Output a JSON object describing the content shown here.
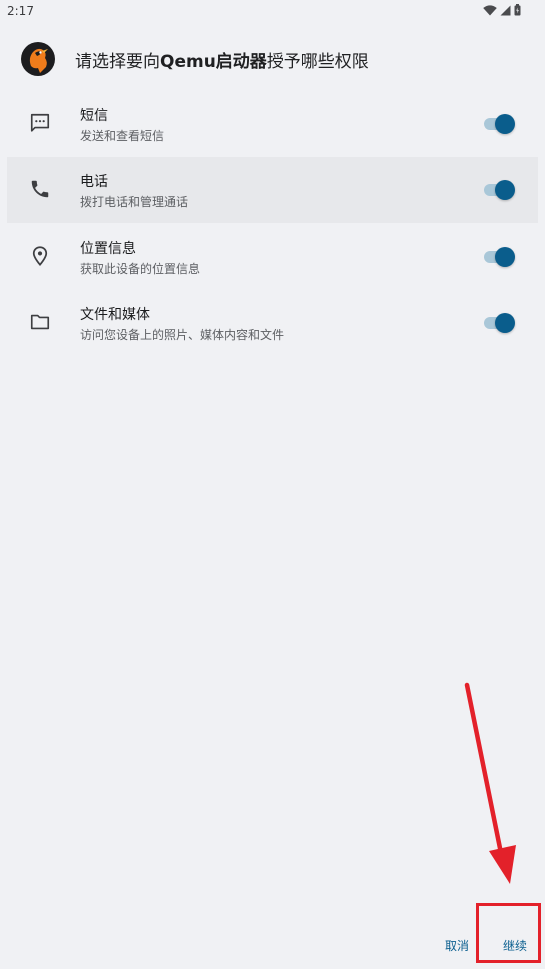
{
  "status_bar": {
    "time": "2:17",
    "icons": [
      "wifi-icon",
      "signal-icon",
      "battery-icon"
    ]
  },
  "header": {
    "prefix": "请选择要向",
    "app_name": "Qemu启动器",
    "suffix": "授予哪些权限"
  },
  "permissions": [
    {
      "title": "短信",
      "description": "发送和查看短信",
      "icon": "sms-icon",
      "enabled": true
    },
    {
      "title": "电话",
      "description": "拨打电话和管理通话",
      "icon": "phone-icon",
      "enabled": true
    },
    {
      "title": "位置信息",
      "description": "获取此设备的位置信息",
      "icon": "location-icon",
      "enabled": true
    },
    {
      "title": "文件和媒体",
      "description": "访问您设备上的照片、媒体内容和文件",
      "icon": "folder-icon",
      "enabled": true
    }
  ],
  "buttons": {
    "cancel": "取消",
    "continue": "继续"
  },
  "colors": {
    "accent": "#0a5d8c",
    "track": "#a9c7d8",
    "annotation": "#e3212a",
    "background": "#f0f1f4"
  }
}
